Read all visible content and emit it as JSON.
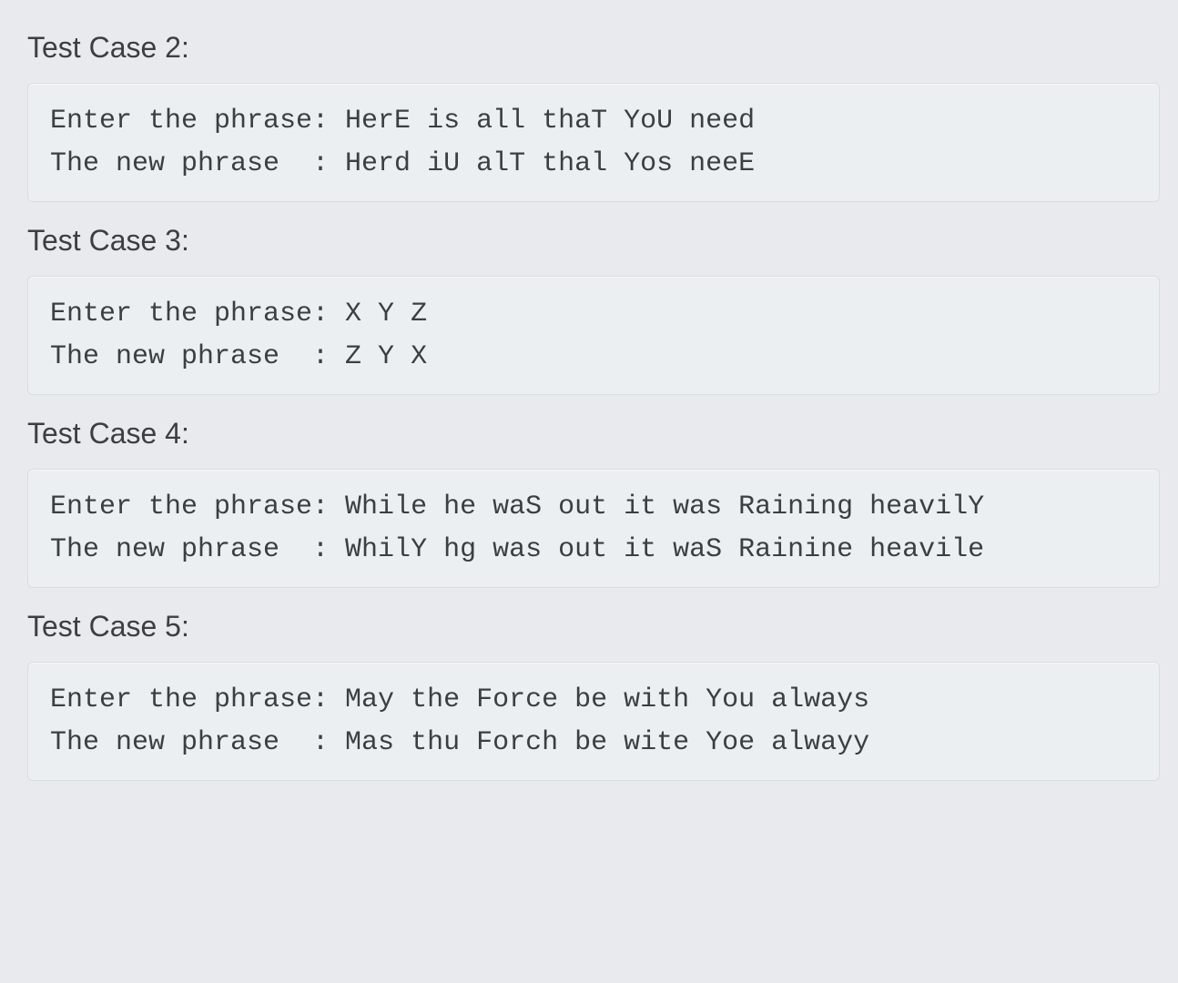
{
  "testcases": [
    {
      "title": "Test Case 2:",
      "code": "Enter the phrase: HerE is all thaT YoU need\nThe new phrase  : Herd iU alT thal Yos neeE"
    },
    {
      "title": "Test Case 3:",
      "code": "Enter the phrase: X Y Z\nThe new phrase  : Z Y X"
    },
    {
      "title": "Test Case 4:",
      "code": "Enter the phrase: While he waS out it was Raining heavilY\nThe new phrase  : WhilY hg was out it waS Rainine heavile"
    },
    {
      "title": "Test Case 5:",
      "code": "Enter the phrase: May the Force be with You always\nThe new phrase  : Mas thu Forch be wite Yoe alwayy"
    }
  ]
}
